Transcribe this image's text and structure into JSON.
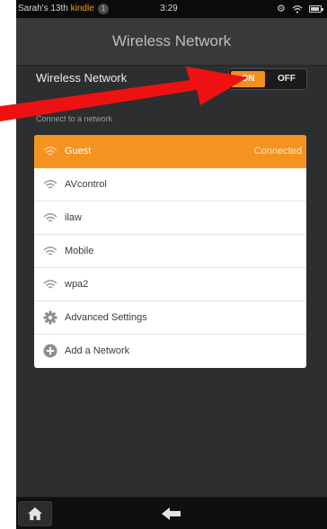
{
  "status_bar": {
    "owner": "Sarah's 13th",
    "brand": "kindle",
    "badge": "1",
    "time": "3:29",
    "icons": [
      "gear-icon",
      "wifi-icon",
      "battery-icon"
    ]
  },
  "header": {
    "title": "Wireless Network"
  },
  "wireless_toggle": {
    "label": "Wireless Network",
    "on_label": "ON",
    "off_label": "OFF",
    "state": "on"
  },
  "networks_section": {
    "header": "Connect to a network",
    "items": [
      {
        "name": "Guest",
        "status": "Connected",
        "icon": "wifi-icon"
      },
      {
        "name": "AVcontrol",
        "icon": "wifi-icon"
      },
      {
        "name": "ilaw",
        "icon": "wifi-icon"
      },
      {
        "name": "Mobile",
        "icon": "wifi-icon"
      },
      {
        "name": "wpa2",
        "icon": "wifi-icon"
      },
      {
        "name": "Advanced Settings",
        "icon": "gear-icon"
      },
      {
        "name": "Add a Network",
        "icon": "plus-circle-icon"
      }
    ]
  },
  "nav_bar": {
    "buttons": [
      "home-icon",
      "back-arrow-icon"
    ]
  },
  "colors": {
    "accent": "#f4931f",
    "background": "#2d2e30",
    "annotation": "#ee1111"
  }
}
